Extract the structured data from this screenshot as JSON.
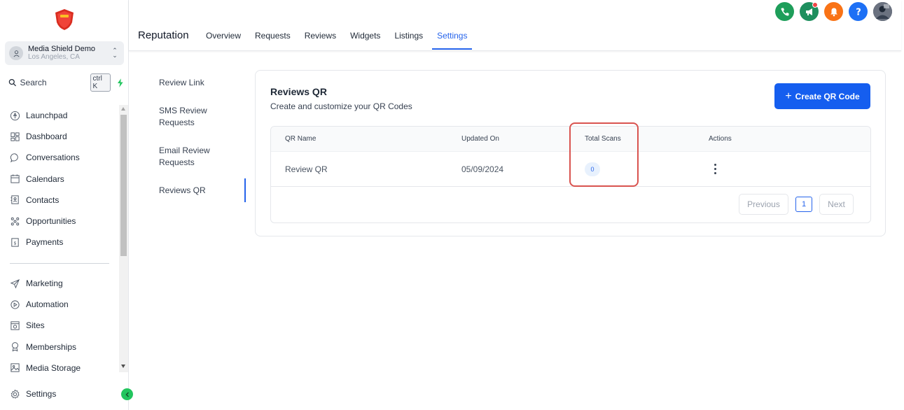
{
  "account": {
    "name": "Media Shield Demo",
    "location": "Los Angeles, CA"
  },
  "search": {
    "placeholder": "Search",
    "shortcut": "ctrl K"
  },
  "sidebar": {
    "primary": [
      {
        "label": "Launchpad",
        "icon": "rocket-icon"
      },
      {
        "label": "Dashboard",
        "icon": "grid-icon"
      },
      {
        "label": "Conversations",
        "icon": "chat-icon"
      },
      {
        "label": "Calendars",
        "icon": "calendar-icon"
      },
      {
        "label": "Contacts",
        "icon": "contacts-icon"
      },
      {
        "label": "Opportunities",
        "icon": "opportunities-icon"
      },
      {
        "label": "Payments",
        "icon": "payments-icon"
      }
    ],
    "secondary": [
      {
        "label": "Marketing",
        "icon": "send-icon"
      },
      {
        "label": "Automation",
        "icon": "automation-icon"
      },
      {
        "label": "Sites",
        "icon": "sites-icon"
      },
      {
        "label": "Memberships",
        "icon": "badge-icon"
      },
      {
        "label": "Media Storage",
        "icon": "image-icon"
      }
    ],
    "settings": {
      "label": "Settings",
      "icon": "gear-icon"
    }
  },
  "header": {
    "title": "Reputation",
    "tabs": [
      "Overview",
      "Requests",
      "Reviews",
      "Widgets",
      "Listings",
      "Settings"
    ],
    "active_tab": "Settings",
    "colors": {
      "phone": "#1e9e5a",
      "megaphone": "#1e8f5e",
      "bell": "#f97316",
      "help": "#1d70f5"
    }
  },
  "subnav": {
    "items": [
      "Review Link",
      "SMS Review Requests",
      "Email Review Requests",
      "Reviews QR"
    ],
    "active": "Reviews QR"
  },
  "card": {
    "title": "Reviews QR",
    "subtitle": "Create and customize your QR Codes",
    "create_button": "Create QR Code",
    "create_icon": "+",
    "columns": [
      "QR Name",
      "Updated On",
      "Total Scans",
      "Actions"
    ],
    "rows": [
      {
        "name": "Review QR",
        "updated": "05/09/2024",
        "scans": "0"
      }
    ],
    "pagination": {
      "previous": "Previous",
      "page": "1",
      "next": "Next"
    }
  },
  "colors": {
    "accent": "#2563eb",
    "primary_button": "#155eef",
    "highlight": "#d9534f"
  }
}
